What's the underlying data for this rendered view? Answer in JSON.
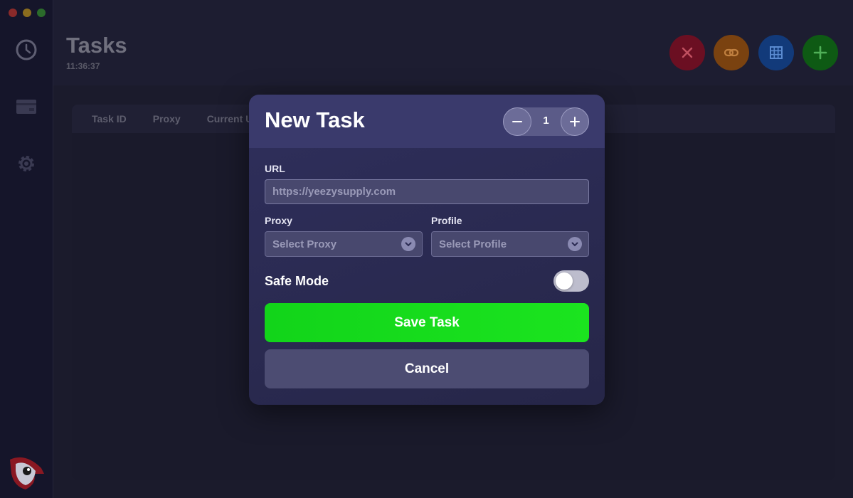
{
  "app": {
    "title": "Tasks",
    "time": "11:36:37"
  },
  "sidebar": {
    "items": [
      {
        "icon": "clock-icon"
      },
      {
        "icon": "credit-card-icon"
      },
      {
        "icon": "gear-icon"
      }
    ]
  },
  "toolbar": {
    "buttons": [
      {
        "icon": "close-icon",
        "color": "#6b0f22"
      },
      {
        "icon": "link-icon",
        "color": "#7a4210"
      },
      {
        "icon": "grid-icon",
        "color": "#123a7a"
      },
      {
        "icon": "plus-icon",
        "color": "#0e5a14"
      }
    ]
  },
  "table": {
    "columns": [
      "Task ID",
      "Proxy",
      "Current U"
    ]
  },
  "modal": {
    "title": "New Task",
    "quantity": "1",
    "url_label": "URL",
    "url_placeholder": "https://yeezysupply.com",
    "url_value": "",
    "proxy_label": "Proxy",
    "proxy_select": "Select Proxy",
    "profile_label": "Profile",
    "profile_select": "Select Profile",
    "safe_mode_label": "Safe Mode",
    "safe_mode_on": false,
    "save_label": "Save Task",
    "cancel_label": "Cancel"
  },
  "colors": {
    "accent_green": "#16dc1c",
    "modal_bg": "#2b2b53"
  }
}
